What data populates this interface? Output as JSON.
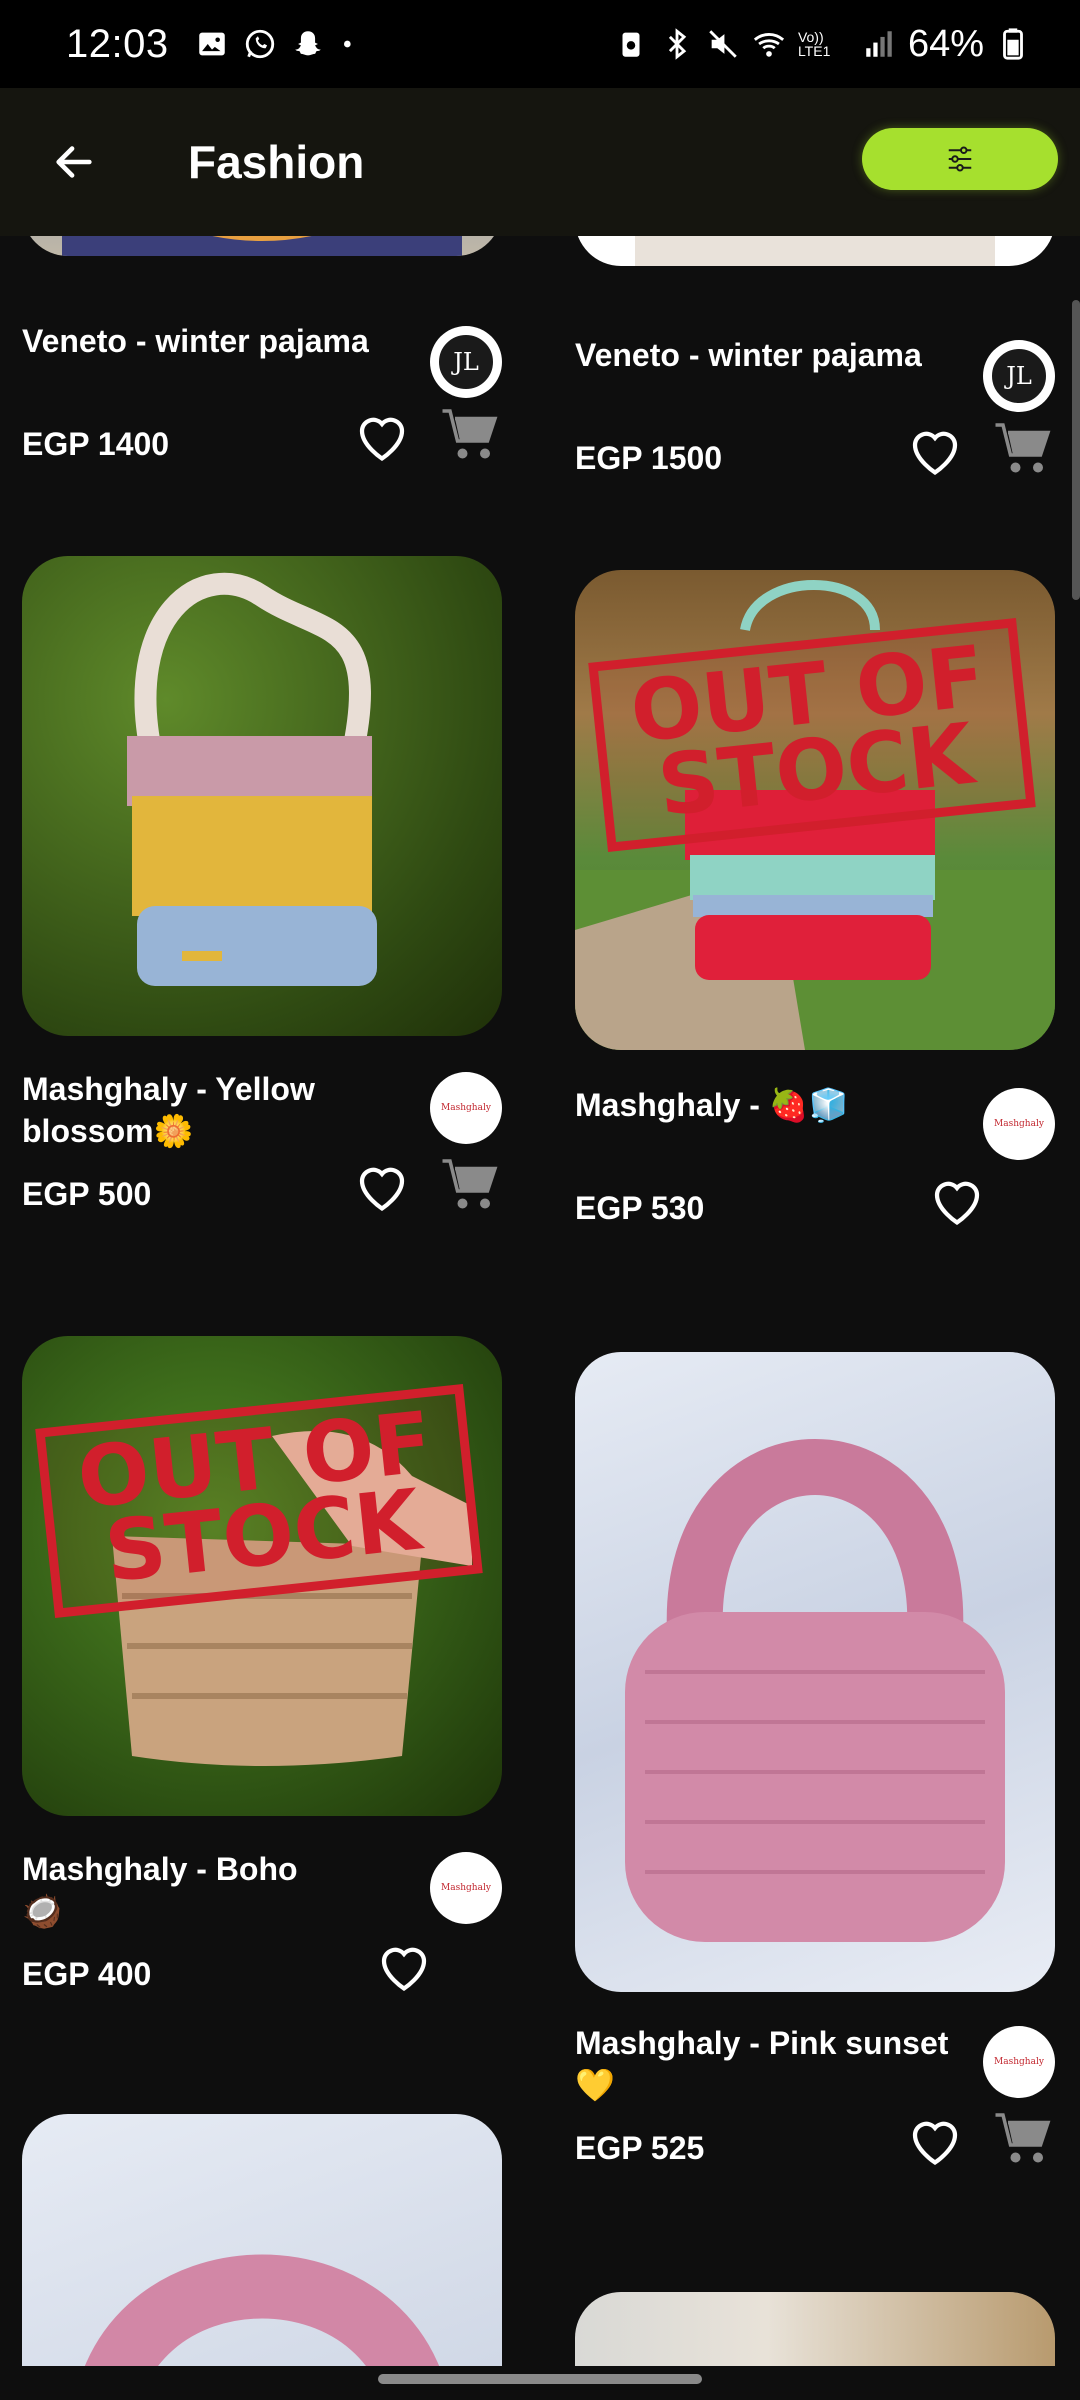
{
  "status_bar": {
    "time": "12:03",
    "battery": "64%",
    "net": "Vo)) LTE1"
  },
  "header": {
    "title": "Fashion"
  },
  "colors": {
    "accent": "#a6e02e",
    "background": "#0e0e0e",
    "out_of_stock": "#d11f2c"
  },
  "products": [
    {
      "title": "Veneto  - winter pajama",
      "price": "EGP 1400",
      "brand": "JL",
      "has_cart": true
    },
    {
      "title": "Veneto  - winter pajama",
      "price": "EGP 1500",
      "brand": "JL",
      "has_cart": true
    },
    {
      "title": "Mashghaly - Yellow blossom🌼",
      "price": "EGP 500",
      "brand": "Mashghaly",
      "has_cart": true
    },
    {
      "title": "Mashghaly - 🍓🧊",
      "price": "EGP 530",
      "brand": "Mashghaly",
      "has_cart": false,
      "stamp": "OUT OF STOCK"
    },
    {
      "title": "Mashghaly - Boho 🥥",
      "price": "EGP 400",
      "brand": "Mashghaly",
      "has_cart": false,
      "stamp": "OUT OF STOCK"
    },
    {
      "title": "Mashghaly - Pink sunset💛",
      "price": "EGP 525",
      "brand": "Mashghaly",
      "has_cart": true
    }
  ],
  "oos_stamp": {
    "line1": "OUT OF",
    "line2": "STOCK"
  },
  "brand_logo_text": "Mashghaly",
  "jl_logo_text": "JL"
}
